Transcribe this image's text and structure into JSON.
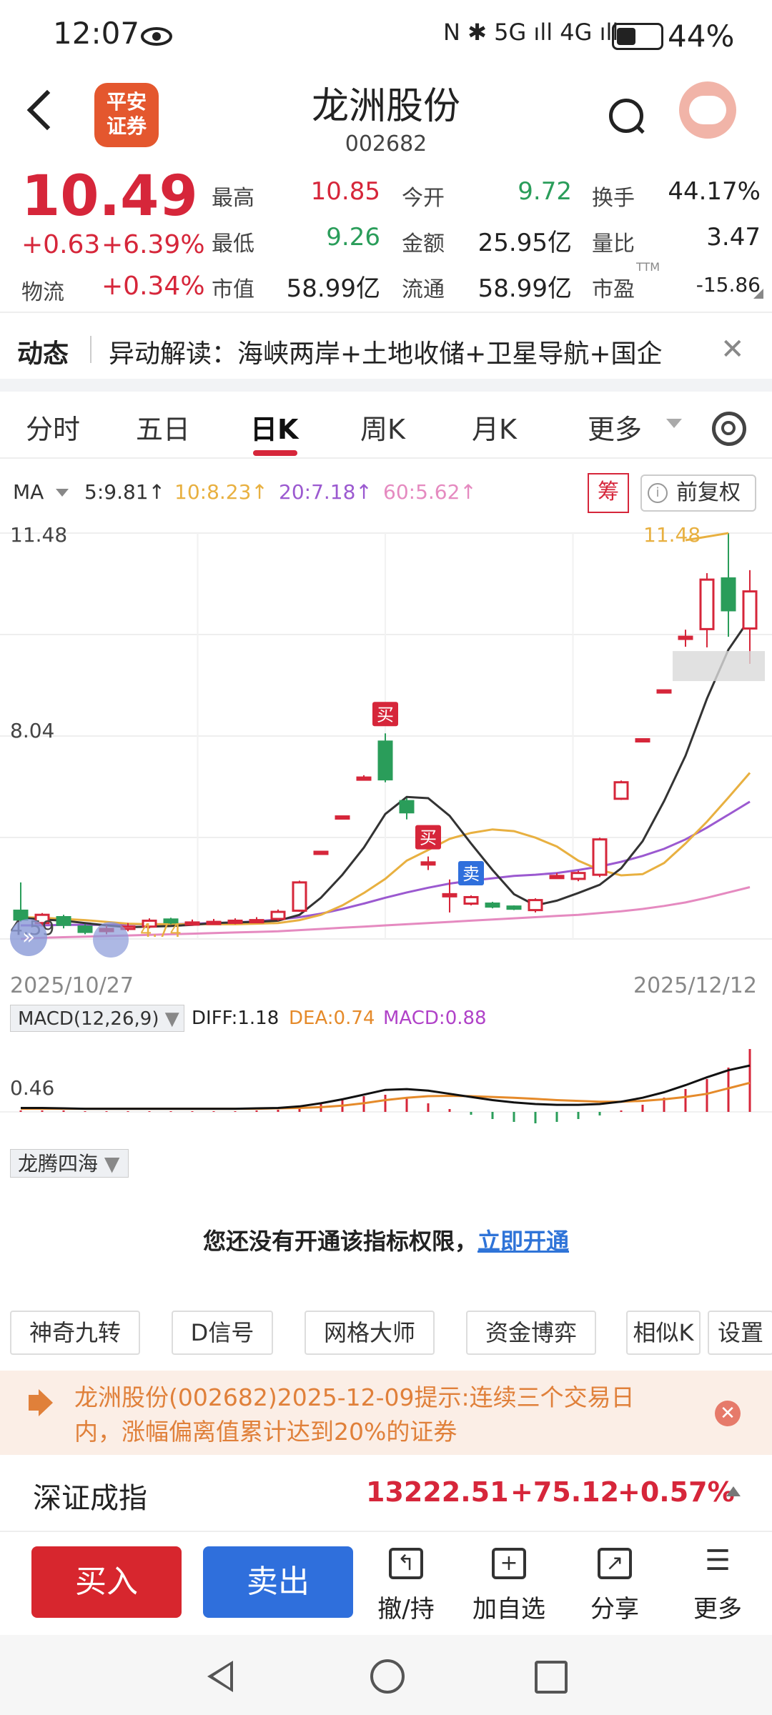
{
  "status": {
    "time": "12:07",
    "network": "N ✱ 5G ıll 4G ıll",
    "battery_pct": "44%",
    "battery_level": 0.44
  },
  "header": {
    "back_label": "",
    "logo_text_1": "平安",
    "logo_text_2": "证券",
    "name": "龙洲股份",
    "code": "002682"
  },
  "quote": {
    "price": "10.49",
    "change": "+0.63",
    "change_pct": "+6.39%",
    "wuliu_label": "物流",
    "wuliu_value": "+0.34%",
    "cells": [
      {
        "label": "最高",
        "value": "10.85",
        "color": "#d6263a"
      },
      {
        "label": "今开",
        "value": "9.72",
        "color": "#2a9d5a"
      },
      {
        "label": "换手",
        "value": "44.17%",
        "color": "#222222"
      },
      {
        "label": "最低",
        "value": "9.26",
        "color": "#2a9d5a"
      },
      {
        "label": "金额",
        "value": "25.95亿",
        "color": "#222222"
      },
      {
        "label": "量比",
        "value": "3.47",
        "color": "#222222"
      },
      {
        "label": "市值",
        "value": "58.99亿",
        "color": "#222222"
      },
      {
        "label": "流通",
        "value": "58.99亿",
        "color": "#222222"
      },
      {
        "label": "市盈",
        "value": "-15.86",
        "color": "#222222"
      }
    ],
    "ttm": "TTM"
  },
  "news": {
    "tag": "动态",
    "text": "异动解读：海峡两岸+土地收储+卫星导航+国企",
    "close": "✕"
  },
  "tabs": [
    {
      "label": "分时"
    },
    {
      "label": "五日"
    },
    {
      "label": "日K"
    },
    {
      "label": "周K"
    },
    {
      "label": "月K"
    },
    {
      "label": "更多"
    }
  ],
  "ma_row": {
    "label": "MA",
    "ma5": "5:9.81↑",
    "ma10": "10:8.23↑",
    "ma20": "20:7.18↑",
    "ma60": "60:5.62↑",
    "chou_label": "筹",
    "fq_label": "前复权"
  },
  "chart_labels": {
    "y_top": "11.48",
    "y_mid": "8.04",
    "y_bottom": "4.59",
    "low_mark": "4.74",
    "high_mark": "11.48",
    "date_start": "2025/10/27",
    "date_end": "2025/12/12",
    "buy1": "买",
    "buy2": "买",
    "sell1": "卖"
  },
  "chart_data": {
    "type": "candlestick",
    "x_range": [
      "2025/10/27",
      "2025/12/12"
    ],
    "ylim": [
      4.59,
      11.48
    ],
    "y_ticks": [
      11.48,
      8.04,
      4.59
    ],
    "candles": [
      {
        "o": 5.07,
        "c": 4.92,
        "h": 5.55,
        "l": 4.88
      },
      {
        "o": 4.86,
        "c": 5.0,
        "h": 5.03,
        "l": 4.8
      },
      {
        "o": 4.96,
        "c": 4.83,
        "h": 5.0,
        "l": 4.77
      },
      {
        "o": 4.8,
        "c": 4.71,
        "h": 4.84,
        "l": 4.67
      },
      {
        "o": 4.74,
        "c": 4.76,
        "h": 4.82,
        "l": 4.67
      },
      {
        "o": 4.76,
        "c": 4.8,
        "h": 4.86,
        "l": 4.72
      },
      {
        "o": 4.8,
        "c": 4.9,
        "h": 4.94,
        "l": 4.77
      },
      {
        "o": 4.92,
        "c": 4.87,
        "h": 4.95,
        "l": 4.84
      },
      {
        "o": 4.86,
        "c": 4.87,
        "h": 4.92,
        "l": 4.82
      },
      {
        "o": 4.87,
        "c": 4.88,
        "h": 4.93,
        "l": 4.83
      },
      {
        "o": 4.88,
        "c": 4.9,
        "h": 4.94,
        "l": 4.84
      },
      {
        "o": 4.91,
        "c": 4.91,
        "h": 4.96,
        "l": 4.86
      },
      {
        "o": 4.93,
        "c": 5.05,
        "h": 5.09,
        "l": 4.9
      },
      {
        "o": 5.07,
        "c": 5.55,
        "h": 5.58,
        "l": 5.05
      },
      {
        "o": 6.07,
        "c": 6.07,
        "h": 6.07,
        "l": 6.07
      },
      {
        "o": 6.67,
        "c": 6.67,
        "h": 6.67,
        "l": 6.67
      },
      {
        "o": 7.33,
        "c": 7.33,
        "h": 7.37,
        "l": 7.3
      },
      {
        "o": 7.94,
        "c": 7.3,
        "h": 8.08,
        "l": 7.25
      },
      {
        "o": 6.93,
        "c": 6.74,
        "h": 6.98,
        "l": 6.62
      },
      {
        "o": 5.89,
        "c": 5.89,
        "h": 5.99,
        "l": 5.76
      },
      {
        "o": 5.35,
        "c": 5.35,
        "h": 5.6,
        "l": 5.04
      },
      {
        "o": 5.19,
        "c": 5.3,
        "h": 5.33,
        "l": 5.16
      },
      {
        "o": 5.19,
        "c": 5.14,
        "h": 5.22,
        "l": 5.11
      },
      {
        "o": 5.14,
        "c": 5.11,
        "h": 5.16,
        "l": 5.08
      },
      {
        "o": 5.08,
        "c": 5.25,
        "h": 5.28,
        "l": 5.04
      },
      {
        "o": 5.66,
        "c": 5.66,
        "h": 5.71,
        "l": 5.62
      },
      {
        "o": 5.61,
        "c": 5.71,
        "h": 5.75,
        "l": 5.57
      },
      {
        "o": 5.68,
        "c": 6.28,
        "h": 6.31,
        "l": 5.64
      },
      {
        "o": 6.97,
        "c": 7.25,
        "h": 7.28,
        "l": 6.95
      },
      {
        "o": 7.98,
        "c": 7.98,
        "h": 7.98,
        "l": 7.98
      },
      {
        "o": 8.81,
        "c": 8.81,
        "h": 8.81,
        "l": 8.81
      },
      {
        "o": 9.72,
        "c": 9.72,
        "h": 9.84,
        "l": 9.55
      },
      {
        "o": 9.85,
        "c": 10.69,
        "h": 10.8,
        "l": 9.54
      },
      {
        "o": 10.71,
        "c": 10.17,
        "h": 11.48,
        "l": 9.72
      },
      {
        "o": 9.86,
        "c": 10.49,
        "h": 10.85,
        "l": 9.26
      }
    ],
    "ma5": [
      4.95,
      4.92,
      4.9,
      4.86,
      4.82,
      4.79,
      4.8,
      4.81,
      4.83,
      4.86,
      4.87,
      4.88,
      4.9,
      5.0,
      5.29,
      5.68,
      6.14,
      6.71,
      7.0,
      6.98,
      6.68,
      6.21,
      5.76,
      5.35,
      5.16,
      5.24,
      5.37,
      5.51,
      5.79,
      6.25,
      6.93,
      7.7,
      8.67,
      9.5,
      10.03
    ],
    "ma10": [
      4.96,
      4.95,
      4.93,
      4.91,
      4.88,
      4.85,
      4.84,
      4.84,
      4.84,
      4.84,
      4.84,
      4.85,
      4.86,
      4.91,
      5.0,
      5.16,
      5.37,
      5.61,
      5.92,
      6.1,
      6.29,
      6.39,
      6.45,
      6.42,
      6.31,
      6.16,
      5.92,
      5.76,
      5.67,
      5.69,
      5.88,
      6.21,
      6.58,
      6.99,
      7.41
    ],
    "ma20": [
      4.82,
      4.82,
      4.83,
      4.83,
      4.83,
      4.84,
      4.84,
      4.84,
      4.85,
      4.86,
      4.87,
      4.89,
      4.92,
      4.96,
      5.02,
      5.1,
      5.19,
      5.29,
      5.38,
      5.46,
      5.53,
      5.58,
      5.62,
      5.66,
      5.68,
      5.71,
      5.76,
      5.82,
      5.9,
      6.0,
      6.12,
      6.28,
      6.48,
      6.7,
      6.92
    ],
    "ma60": [
      4.59,
      4.61,
      4.62,
      4.63,
      4.64,
      4.65,
      4.66,
      4.67,
      4.68,
      4.69,
      4.7,
      4.71,
      4.72,
      4.74,
      4.76,
      4.78,
      4.8,
      4.82,
      4.84,
      4.86,
      4.88,
      4.9,
      4.92,
      4.94,
      4.96,
      4.98,
      5.0,
      5.03,
      5.06,
      5.1,
      5.15,
      5.21,
      5.29,
      5.38,
      5.47
    ],
    "markers": [
      {
        "index": 17,
        "type": "buy"
      },
      {
        "index": 19,
        "type": "buy"
      },
      {
        "index": 21,
        "type": "sell"
      }
    ]
  },
  "macd": {
    "label": "MACD(12,26,9)",
    "diff": "DIFF:1.18",
    "dea": "DEA:0.74",
    "macd": "MACD:0.88",
    "y_label": "0.46",
    "chart_data": {
      "type": "bar+line",
      "hist": [
        0.02,
        0.02,
        0.02,
        0.01,
        0.01,
        0.01,
        0.01,
        0.01,
        0.01,
        0.01,
        0.01,
        0.02,
        0.03,
        0.06,
        0.12,
        0.18,
        0.22,
        0.24,
        0.2,
        0.12,
        0.04,
        -0.04,
        -0.1,
        -0.14,
        -0.16,
        -0.14,
        -0.1,
        -0.05,
        0.02,
        0.1,
        0.2,
        0.32,
        0.46,
        0.62,
        0.88
      ],
      "diff": [
        0.1,
        0.1,
        0.09,
        0.08,
        0.08,
        0.08,
        0.08,
        0.08,
        0.08,
        0.08,
        0.08,
        0.09,
        0.1,
        0.14,
        0.22,
        0.32,
        0.44,
        0.56,
        0.58,
        0.54,
        0.46,
        0.38,
        0.3,
        0.24,
        0.2,
        0.18,
        0.18,
        0.2,
        0.26,
        0.36,
        0.5,
        0.68,
        0.88,
        1.06,
        1.18
      ],
      "dea": [
        0.08,
        0.08,
        0.08,
        0.08,
        0.08,
        0.08,
        0.08,
        0.08,
        0.08,
        0.08,
        0.08,
        0.08,
        0.09,
        0.1,
        0.12,
        0.16,
        0.22,
        0.3,
        0.36,
        0.4,
        0.41,
        0.4,
        0.38,
        0.36,
        0.33,
        0.3,
        0.28,
        0.26,
        0.26,
        0.28,
        0.32,
        0.38,
        0.46,
        0.6,
        0.74
      ]
    }
  },
  "longteng": {
    "label": "龙腾四海",
    "perm_text": "您还没有开通该指标权限，",
    "perm_link": "立即开通"
  },
  "tools": [
    {
      "label": "神奇九转"
    },
    {
      "label": "D信号"
    },
    {
      "label": "网格大师"
    },
    {
      "label": "资金博弈"
    },
    {
      "label": "相似K"
    },
    {
      "label": "设置"
    }
  ],
  "alert": {
    "text": "龙洲股份(002682)2025-12-09提示:连续三个交易日内，涨幅偏离值累计达到20%的证券"
  },
  "index": {
    "name": "深证成指",
    "value": "13222.51",
    "change": "+75.12",
    "change_pct": "+0.57%"
  },
  "actions": {
    "buy": "买入",
    "sell": "卖出",
    "items": [
      {
        "label": "撤/持"
      },
      {
        "label": "加自选"
      },
      {
        "label": "分享"
      },
      {
        "label": "更多"
      }
    ]
  },
  "colors": {
    "up": "#d6263a",
    "down": "#2a9d5a",
    "ma5": "#333333",
    "ma10": "#e8b040",
    "ma20": "#9b59d0",
    "ma60": "#e58ac0",
    "accent_blue": "#2f6fdc"
  }
}
